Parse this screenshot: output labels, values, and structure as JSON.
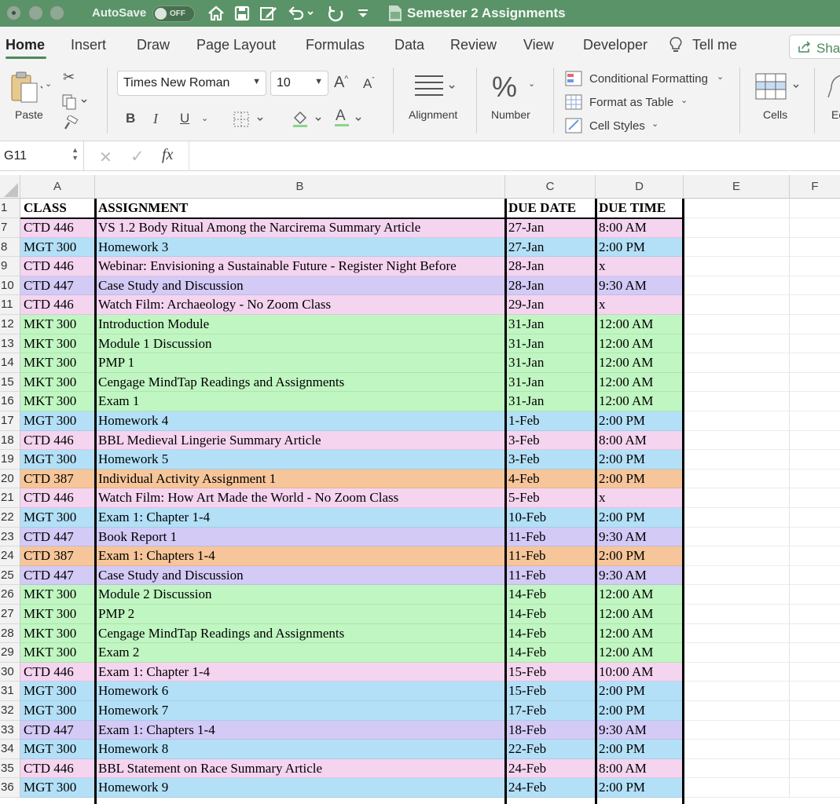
{
  "titlebar": {
    "autosave_label": "AutoSave",
    "autosave_state": "OFF",
    "doc_title": "Semester 2 Assignments",
    "icons": [
      "home-icon",
      "save-icon",
      "edit-icon",
      "undo-icon",
      "redo-icon",
      "customize-icon",
      "document-icon"
    ]
  },
  "tabs": [
    "Home",
    "Insert",
    "Draw",
    "Page Layout",
    "Formulas",
    "Data",
    "Review",
    "View",
    "Developer"
  ],
  "tell_me": "Tell me",
  "share": "Sha",
  "ribbon": {
    "paste": "Paste",
    "font_name": "Times New Roman",
    "font_size": "10",
    "alignment": "Alignment",
    "number": "Number",
    "conditional_formatting": "Conditional Formatting",
    "format_as_table": "Format as Table",
    "cell_styles": "Cell Styles",
    "cells": "Cells",
    "editing_partial": "Ec"
  },
  "formula_bar": {
    "name_box": "G11",
    "fx": "fx",
    "formula": ""
  },
  "colors": {
    "titlebar": "#5a9367",
    "CTD 446": "#f5d4f0",
    "MGT 300": "#b3e0f7",
    "CTD 447": "#d3caf6",
    "MKT 300": "#c0f6c1",
    "CTD 387": "#f6c599"
  },
  "sheet": {
    "column_headers": [
      "A",
      "B",
      "C",
      "D",
      "E",
      "F"
    ],
    "header_row": {
      "num": "1",
      "cells": [
        "CLASS",
        "ASSIGNMENT",
        "DUE DATE",
        "DUE TIME"
      ]
    },
    "rows": [
      {
        "num": "7",
        "cells": [
          "CTD 446",
          "VS 1.2 Body Ritual Among the Narcirema Summary Article",
          "27-Jan",
          "8:00 AM"
        ]
      },
      {
        "num": "8",
        "cells": [
          "MGT 300",
          "Homework 3",
          "27-Jan",
          "2:00 PM"
        ]
      },
      {
        "num": "9",
        "cells": [
          "CTD 446",
          "Webinar: Envisioning a Sustainable Future - Register Night Before",
          "28-Jan",
          "x"
        ]
      },
      {
        "num": "10",
        "cells": [
          "CTD 447",
          "Case Study and Discussion",
          "28-Jan",
          "9:30 AM"
        ]
      },
      {
        "num": "11",
        "cells": [
          "CTD 446",
          "Watch Film: Archaeology - No Zoom Class",
          "29-Jan",
          "x"
        ]
      },
      {
        "num": "12",
        "cells": [
          "MKT 300",
          "Introduction Module",
          "31-Jan",
          "12:00 AM"
        ]
      },
      {
        "num": "13",
        "cells": [
          "MKT 300",
          "Module 1 Discussion",
          "31-Jan",
          "12:00 AM"
        ]
      },
      {
        "num": "14",
        "cells": [
          "MKT 300",
          "PMP 1",
          "31-Jan",
          "12:00 AM"
        ]
      },
      {
        "num": "15",
        "cells": [
          "MKT 300",
          "Cengage MindTap Readings and Assignments",
          "31-Jan",
          "12:00 AM"
        ]
      },
      {
        "num": "16",
        "cells": [
          "MKT 300",
          "Exam 1",
          "31-Jan",
          "12:00 AM"
        ]
      },
      {
        "num": "17",
        "cells": [
          "MGT 300",
          "Homework 4",
          "1-Feb",
          "2:00 PM"
        ]
      },
      {
        "num": "18",
        "cells": [
          "CTD 446",
          "BBL Medieval Lingerie Summary Article",
          "3-Feb",
          "8:00 AM"
        ]
      },
      {
        "num": "19",
        "cells": [
          "MGT 300",
          "Homework 5",
          "3-Feb",
          "2:00 PM"
        ]
      },
      {
        "num": "20",
        "cells": [
          "CTD 387",
          "Individual Activity Assignment 1",
          "4-Feb",
          "2:00 PM"
        ]
      },
      {
        "num": "21",
        "cells": [
          "CTD 446",
          "Watch Film: How Art Made the World - No Zoom Class",
          "5-Feb",
          "x"
        ]
      },
      {
        "num": "22",
        "cells": [
          "MGT 300",
          "Exam 1: Chapter 1-4",
          "10-Feb",
          "2:00 PM"
        ]
      },
      {
        "num": "23",
        "cells": [
          "CTD 447",
          "Book Report 1",
          "11-Feb",
          "9:30 AM"
        ]
      },
      {
        "num": "24",
        "cells": [
          "CTD 387",
          "Exam 1: Chapters 1-4",
          "11-Feb",
          "2:00 PM"
        ]
      },
      {
        "num": "25",
        "cells": [
          "CTD 447",
          "Case Study and Discussion",
          "11-Feb",
          "9:30 AM"
        ]
      },
      {
        "num": "26",
        "cells": [
          "MKT 300",
          "Module 2 Discussion",
          "14-Feb",
          "12:00 AM"
        ]
      },
      {
        "num": "27",
        "cells": [
          "MKT 300",
          "PMP 2",
          "14-Feb",
          "12:00 AM"
        ]
      },
      {
        "num": "28",
        "cells": [
          "MKT 300",
          "Cengage MindTap Readings and Assignments",
          "14-Feb",
          "12:00 AM"
        ]
      },
      {
        "num": "29",
        "cells": [
          "MKT 300",
          "Exam 2",
          "14-Feb",
          "12:00 AM"
        ]
      },
      {
        "num": "30",
        "cells": [
          "CTD 446",
          "Exam 1: Chapter 1-4",
          "15-Feb",
          "10:00 AM"
        ]
      },
      {
        "num": "31",
        "cells": [
          "MGT 300",
          "Homework 6",
          "15-Feb",
          "2:00 PM"
        ]
      },
      {
        "num": "32",
        "cells": [
          "MGT 300",
          "Homework 7",
          "17-Feb",
          "2:00 PM"
        ]
      },
      {
        "num": "33",
        "cells": [
          "CTD 447",
          "Exam 1: Chapters 1-4",
          "18-Feb",
          "9:30 AM"
        ]
      },
      {
        "num": "34",
        "cells": [
          "MGT 300",
          "Homework 8",
          "22-Feb",
          "2:00 PM"
        ]
      },
      {
        "num": "35",
        "cells": [
          "CTD 446",
          "BBL Statement on Race Summary Article",
          "24-Feb",
          "8:00 AM"
        ]
      },
      {
        "num": "36",
        "cells": [
          "MGT 300",
          "Homework 9",
          "24-Feb",
          "2:00 PM"
        ]
      }
    ]
  }
}
